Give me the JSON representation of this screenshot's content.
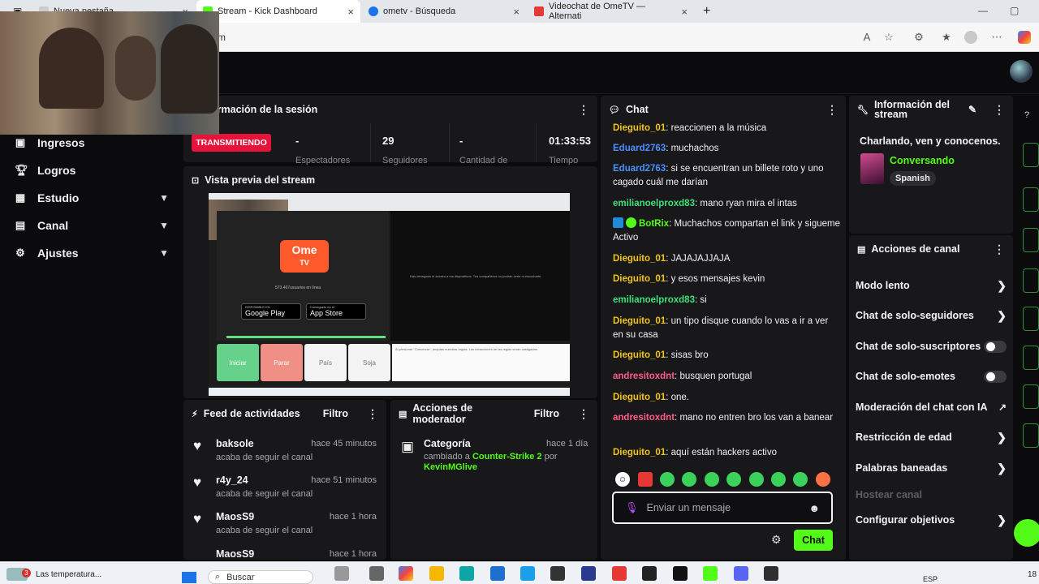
{
  "browser": {
    "tabs": [
      {
        "title": "Nueva pestaña"
      },
      {
        "title": "Stream - Kick Dashboard"
      },
      {
        "title": "ometv - Búsqueda"
      },
      {
        "title": "Videochat de OmeTV — Alternati"
      }
    ],
    "url": "m"
  },
  "sidebar": {
    "items": [
      {
        "label": "Ingresos",
        "icon": "wallet-icon"
      },
      {
        "label": "Logros",
        "icon": "trophy-icon"
      },
      {
        "label": "Estudio",
        "icon": "layout-icon"
      },
      {
        "label": "Canal",
        "icon": "channel-icon"
      },
      {
        "label": "Ajustes",
        "icon": "gear-icon"
      }
    ]
  },
  "session": {
    "title": "ormación de la sesión",
    "status": "TRANSMITIENDO",
    "stats": [
      {
        "value": "-",
        "label": "Espectadores"
      },
      {
        "value": "29",
        "label": "Seguidores"
      },
      {
        "value": "-",
        "label": "Cantidad de"
      },
      {
        "value": "01:33:53",
        "label": "Tiempo"
      }
    ]
  },
  "preview": {
    "title": "Vista previa del stream",
    "ome_logo": "Ome",
    "ome_tv": "TV",
    "online": "573.467usuarios en línea",
    "google_play_top": "DISPONIBLE EN",
    "google_play": "Google Play",
    "app_store_top": "Consíguelo en el",
    "app_store": "App Store",
    "camera_msg": "Has denegado el acceso a tus dispositivos. Tus compañeros no podrán verte ni escucharte.",
    "btn_start": "Iniciar",
    "btn_stop": "Parar",
    "btn_country": "País",
    "btn_gender": "Soja",
    "rules_text": "Al presionar \"Comenzar\", aceptas nuestras reglas. Las infracciones de las reglas serán castigadas."
  },
  "feed": {
    "title": "Feed de actividades",
    "filter": "Filtro",
    "items": [
      {
        "name": "baksole",
        "action": "acaba de seguir el canal",
        "time": "hace 45 minutos"
      },
      {
        "name": "r4y_24",
        "action": "acaba de seguir el canal",
        "time": "hace 51 minutos"
      },
      {
        "name": "MaosS9",
        "action": "acaba de seguir el canal",
        "time": "hace 1 hora"
      },
      {
        "name": "MaosS9",
        "action": "",
        "time": "hace 1 hora"
      }
    ]
  },
  "mod": {
    "title": "Acciones de moderador",
    "filter": "Filtro",
    "item": {
      "label": "Categoría",
      "time": "hace 1 día",
      "changed": "cambiado a",
      "category": "Counter-Strike 2",
      "by": "por",
      "user": "KevinMGlive"
    }
  },
  "chat": {
    "title": "Chat",
    "messages": [
      {
        "user": "Dieguito_01",
        "color": "#f0c419",
        "text": "reaccionen a la música"
      },
      {
        "user": "Eduard2763",
        "color": "#4a90ff",
        "text": "muchachos"
      },
      {
        "user": "Eduard2763",
        "color": "#4a90ff",
        "text": "si se encuentran un billete roto y uno cagado cuál me darían"
      },
      {
        "user": "emilianoelproxd83",
        "color": "#3ee07a",
        "text": "mano ryan mira el intas"
      },
      {
        "user": "BotRix",
        "color": "#53fc18",
        "text": "Muchachos compartan el link y siguеme Activo"
      },
      {
        "user": "Dieguito_01",
        "color": "#f0c419",
        "text": "JAJAJAJJAJA"
      },
      {
        "user": "Dieguito_01",
        "color": "#f0c419",
        "text": "y esos mensajes kevin"
      },
      {
        "user": "emilianoelproxd83",
        "color": "#3ee07a",
        "text": "si"
      },
      {
        "user": "Dieguito_01",
        "color": "#f0c419",
        "text": "un tipo disque cuando lo vas a ir a ver en su casa"
      },
      {
        "user": "Dieguito_01",
        "color": "#f0c419",
        "text": "sisas bro"
      },
      {
        "user": "andresitoxdnt",
        "color": "#ff5c8a",
        "text": "busquen portugal"
      },
      {
        "user": "Dieguito_01",
        "color": "#f0c419",
        "text": "one."
      },
      {
        "user": "andresitoxdnt",
        "color": "#ff5c8a",
        "text": "mano no entren bro los van a banear"
      },
      {
        "user": "Dieguito_01",
        "color": "#f0c419",
        "text": "aquí están hackers activo"
      }
    ],
    "placeholder": "Enviar un mensaje",
    "send": "Chat"
  },
  "stream_info": {
    "title": "Información del stream",
    "description": "Charlando, ven y conocenos.",
    "category": "Conversando",
    "language": "Spanish"
  },
  "actions": {
    "title": "Acciones de canal",
    "items": [
      {
        "label": "Modo lento",
        "control": "chevron"
      },
      {
        "label": "Chat de solo-seguidores",
        "control": "chevron"
      },
      {
        "label": "Chat de solo-suscriptores",
        "control": "toggle"
      },
      {
        "label": "Chat de solo-emotes",
        "control": "toggle"
      },
      {
        "label": "Moderación del chat con IA",
        "control": "external"
      },
      {
        "label": "Restricción de edad",
        "control": "chevron"
      },
      {
        "label": "Palabras baneadas",
        "control": "chevron"
      },
      {
        "label": "Hostear canal",
        "control": "disabled"
      },
      {
        "label": "Configurar objetivos",
        "control": "chevron"
      }
    ]
  },
  "taskbar": {
    "weather": "Las temperatura...",
    "weather_badge": "3",
    "search": "Buscar",
    "lang": "ESP",
    "time": "18"
  },
  "colors": {
    "brand": "#53fc18",
    "live": "#e6143a",
    "panel": "#18181b",
    "background": "#0b0b0d"
  }
}
